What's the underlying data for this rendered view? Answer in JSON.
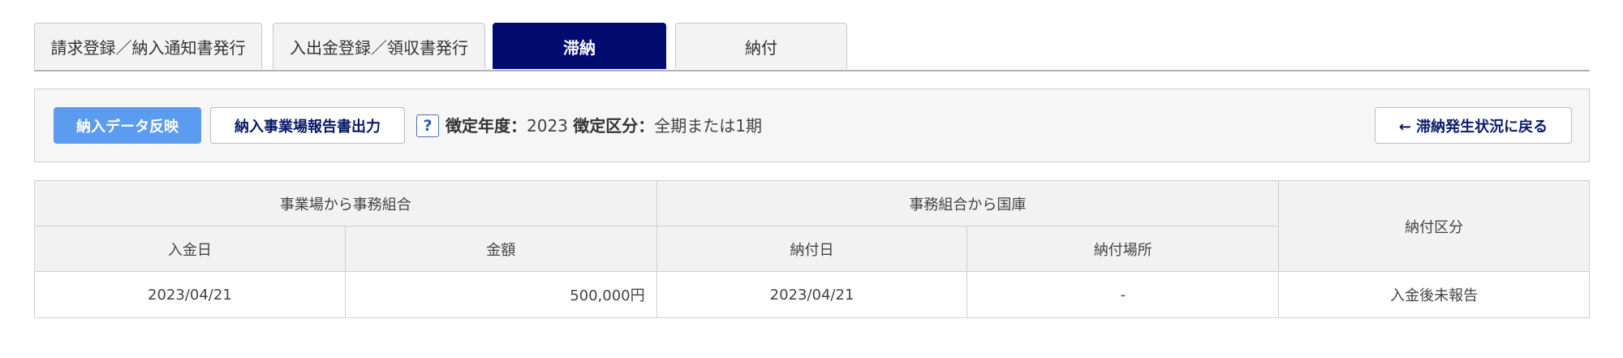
{
  "tabs": [
    {
      "label": "請求登録／納入通知書発行",
      "active": false
    },
    {
      "label": "入出金登録／領収書発行",
      "active": false
    },
    {
      "label": "滞納",
      "active": true
    },
    {
      "label": "納付",
      "active": false
    }
  ],
  "toolbar": {
    "reflect_button": "納入データ反映",
    "report_button": "納入事業場報告書出力",
    "help_icon_glyph": "?",
    "year_label": "徴定年度：",
    "year_value": "2023",
    "category_label": "徴定区分：",
    "category_value": "全期または1期",
    "back_button": "← 滞納発生状況に戻る"
  },
  "table": {
    "group_headers": [
      "事業場から事務組合",
      "事務組合から国庫"
    ],
    "category_header": "納付区分",
    "columns": [
      "入金日",
      "金額",
      "納付日",
      "納付場所"
    ],
    "rows": [
      [
        "2023/04/21",
        "500,000円",
        "2023/04/21",
        "-",
        "入金後未報告"
      ]
    ]
  },
  "colors": {
    "active_tab": "#000b6e",
    "primary_button": "#5b9cf0",
    "outline_button_text": "#0a1a6b"
  },
  "icons": [
    "help-icon",
    "arrow-left-icon"
  ]
}
